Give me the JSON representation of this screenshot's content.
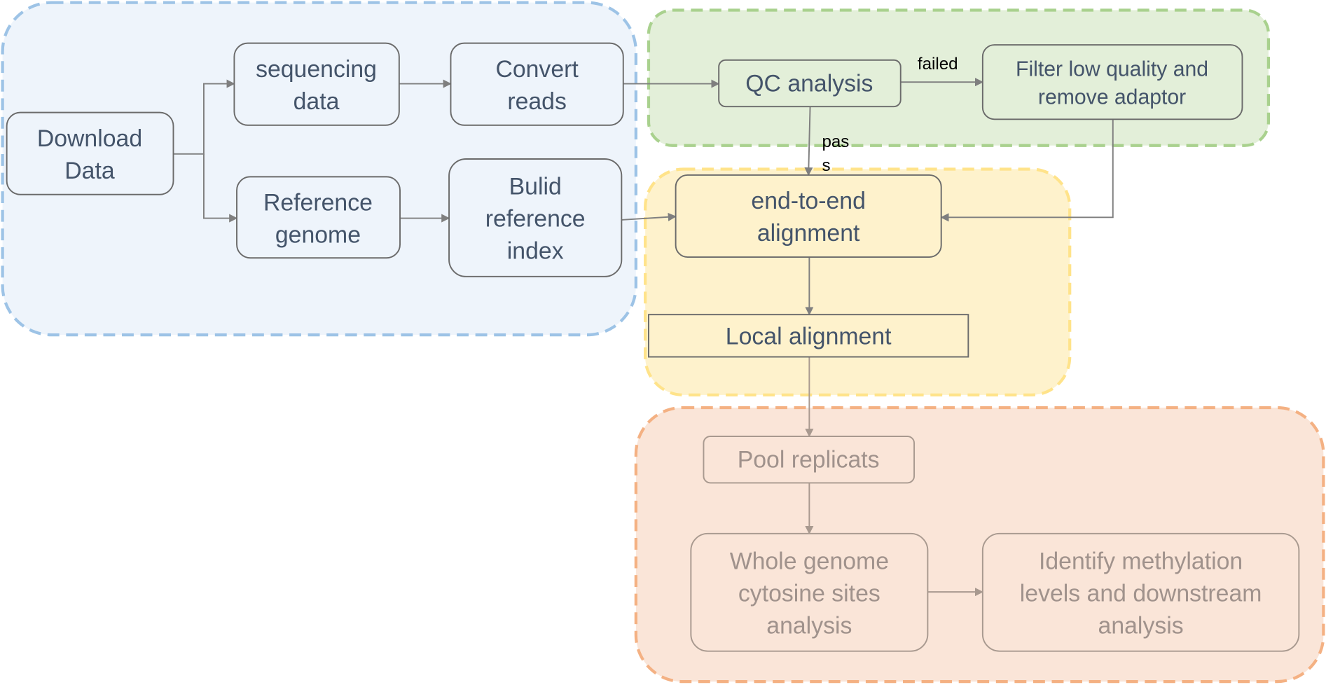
{
  "colors": {
    "stage1_fill": "#eef4fb",
    "stage1_border": "#9dc3e6",
    "stage2_fill": "#e3efd9",
    "stage2_border": "#a9d18e",
    "stage3_fill": "#fef2cc",
    "stage3_border": "#ffe38a",
    "stage4_fill": "#fae5d8",
    "stage4_border": "#f4b183",
    "text": "#44546a",
    "faded_text": "#a0928c"
  },
  "nodes": {
    "download": [
      "Download",
      "Data"
    ],
    "sequencing": [
      "sequencing",
      "data"
    ],
    "convert": [
      "Convert",
      "reads"
    ],
    "reference": [
      "Reference",
      "genome"
    ],
    "build_index": [
      "Bulid",
      "reference",
      "index"
    ],
    "qc": [
      "QC analysis"
    ],
    "filter": [
      "Filter low quality and",
      "remove adaptor"
    ],
    "end_to_end": [
      "end-to-end",
      "alignment"
    ],
    "local": [
      "Local alignment"
    ],
    "pool": [
      "Pool replicats"
    ],
    "whole_genome": [
      "Whole genome",
      "cytosine sites",
      "analysis"
    ],
    "identify": [
      "Identify methylation",
      "levels and downstream",
      "analysis"
    ]
  },
  "edge_labels": {
    "failed": "failed",
    "pass": [
      "pas",
      "s"
    ]
  }
}
